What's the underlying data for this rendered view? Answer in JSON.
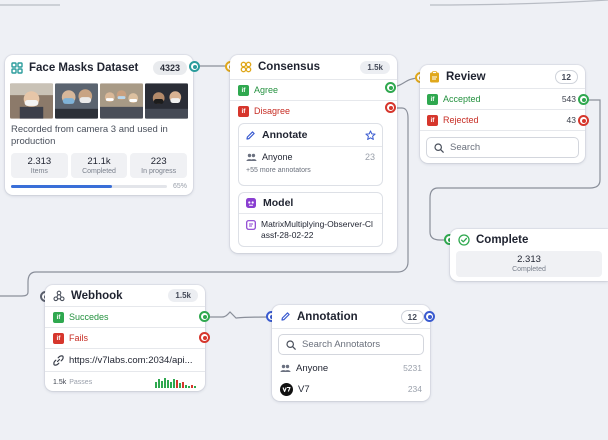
{
  "dataset": {
    "title": "Face Masks Dataset",
    "count": "4323",
    "description": "Recorded from camera 3 and used in production",
    "stats": [
      {
        "value": "2.313",
        "label": "Items"
      },
      {
        "value": "21.1k",
        "label": "Completed"
      },
      {
        "value": "223",
        "label": "In progress"
      }
    ],
    "progress_percent": 65,
    "progress_label": "65%"
  },
  "consensus": {
    "title": "Consensus",
    "count": "1.5k",
    "agree_label": "Agree",
    "disagree_label": "Disagree",
    "annotate": {
      "title": "Annotate",
      "assignee": "Anyone",
      "assignee_count": "23",
      "more": "+55 more annotators"
    },
    "model": {
      "title": "Model",
      "name": "MatrixMultiplying-Observer-Classf-28-02-22"
    }
  },
  "review": {
    "title": "Review",
    "count": "12",
    "accepted_label": "Accepted",
    "accepted_count": "543",
    "rejected_label": "Rejected",
    "rejected_count": "43",
    "search_placeholder": "Search"
  },
  "complete": {
    "title": "Complete",
    "value": "2.313",
    "label": "Completed"
  },
  "webhook": {
    "title": "Webhook",
    "count": "1.5k",
    "succeeds_label": "Succedes",
    "fails_label": "Fails",
    "url": "https://v7labs.com:2034/api...",
    "passes_count": "1.5k",
    "passes_label": "Passes"
  },
  "annotation": {
    "title": "Annotation",
    "count": "12",
    "search_placeholder": "Search Annotators",
    "annotators": [
      {
        "name": "Anyone",
        "count": "5231",
        "icon": "people-icon"
      },
      {
        "name": "V7",
        "count": "234",
        "icon": "v7-logo"
      }
    ]
  },
  "colors": {
    "accent": "#3a5bd0",
    "success": "#2fa84f",
    "danger": "#d6362c",
    "consensus": "#e0a81c",
    "dataset": "#2a9c9c"
  }
}
